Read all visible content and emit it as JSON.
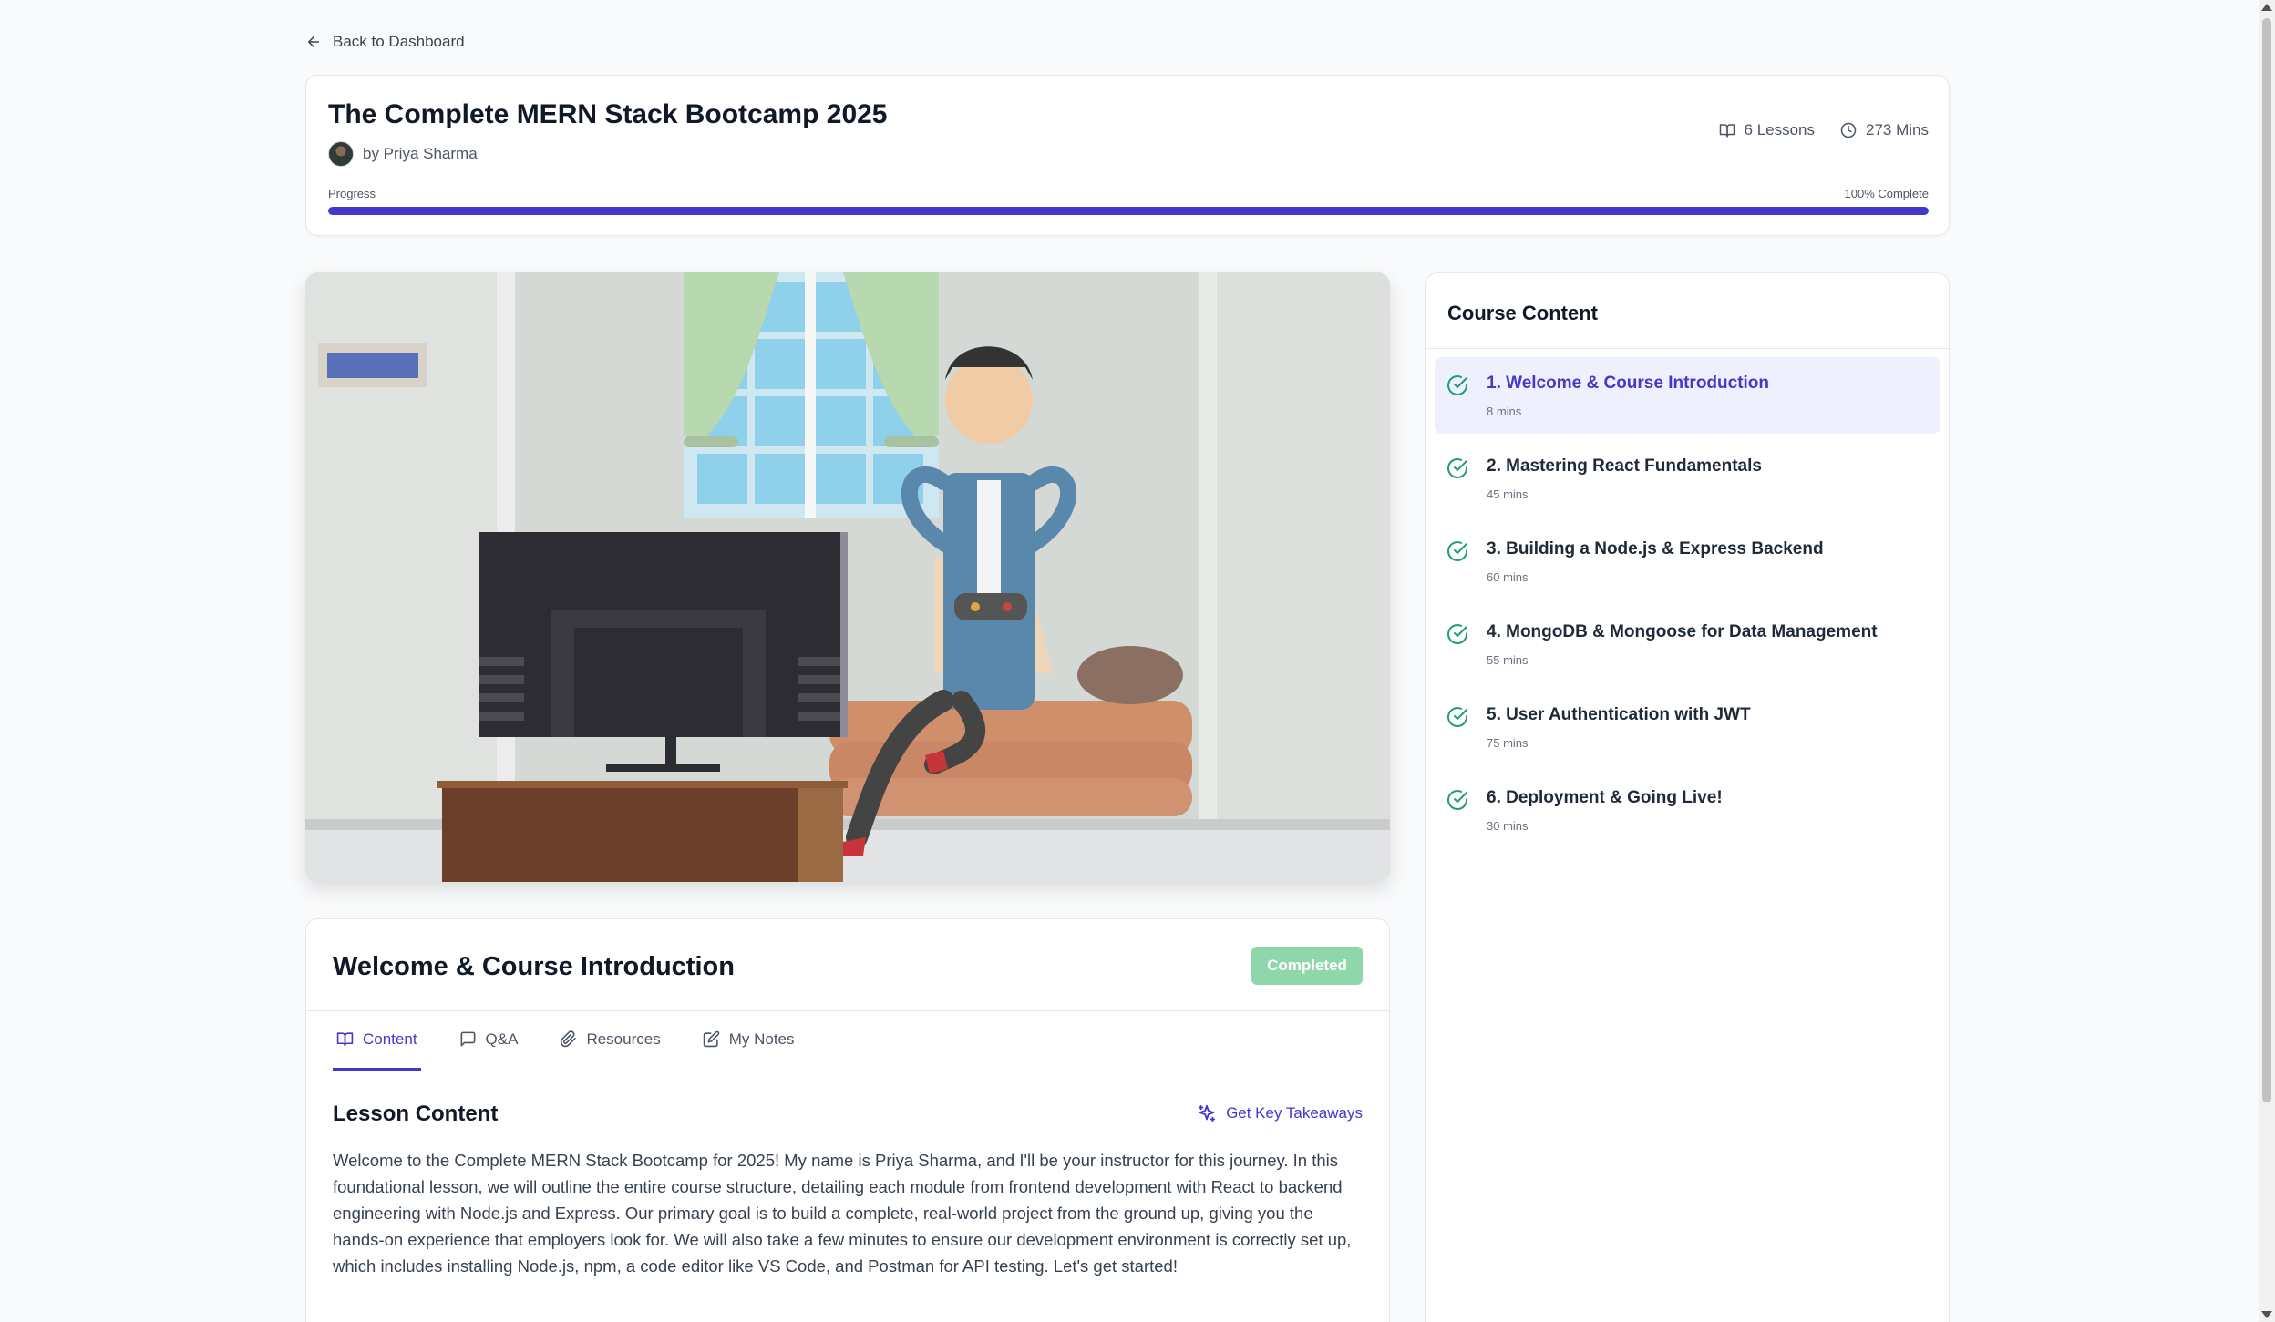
{
  "nav": {
    "back_label": "Back to Dashboard"
  },
  "course": {
    "title": "The Complete MERN Stack Bootcamp 2025",
    "author": "by Priya Sharma",
    "lessons_count": "6 Lessons",
    "total_duration": "273 Mins",
    "progress_label": "Progress",
    "progress_text": "100% Complete",
    "progress_fraction": 1.0
  },
  "video": {
    "thumbnail_icon": "cartoon-man-gaming-illustration"
  },
  "lesson": {
    "title": "Welcome & Course Introduction",
    "status": "Completed",
    "tabs": [
      {
        "label": "Content",
        "icon": "book-icon",
        "active": true
      },
      {
        "label": "Q&A",
        "icon": "message-icon",
        "active": false
      },
      {
        "label": "Resources",
        "icon": "paperclip-icon",
        "active": false
      },
      {
        "label": "My Notes",
        "icon": "edit-icon",
        "active": false
      }
    ],
    "content_heading": "Lesson Content",
    "takeaways_label": "Get Key Takeaways",
    "body": "Welcome to the Complete MERN Stack Bootcamp for 2025! My name is Priya Sharma, and I'll be your instructor for this journey. In this foundational lesson, we will outline the entire course structure, detailing each module from frontend development with React to backend engineering with Node.js and Express. Our primary goal is to build a complete, real-world project from the ground up, giving you the hands-on experience that employers look for. We will also take a few minutes to ensure our development environment is correctly set up, which includes installing Node.js, npm, a code editor like VS Code, and Postman for API testing. Let's get started!"
  },
  "sidebar": {
    "title": "Course Content",
    "items": [
      {
        "label": "1. Welcome & Course Introduction",
        "duration": "8 mins",
        "active": true
      },
      {
        "label": "2. Mastering React Fundamentals",
        "duration": "45 mins",
        "active": false
      },
      {
        "label": "3. Building a Node.js & Express Backend",
        "duration": "60 mins",
        "active": false
      },
      {
        "label": "4. MongoDB & Mongoose for Data Management",
        "duration": "55 mins",
        "active": false
      },
      {
        "label": "5. User Authentication with JWT",
        "duration": "75 mins",
        "active": false
      },
      {
        "label": "6. Deployment & Going Live!",
        "duration": "30 mins",
        "active": false
      }
    ]
  },
  "colors": {
    "accent": "#4338ca",
    "completed_badge": "#8fd6a8",
    "check_green": "#22a06b",
    "active_item_bg": "#eef0fd"
  }
}
